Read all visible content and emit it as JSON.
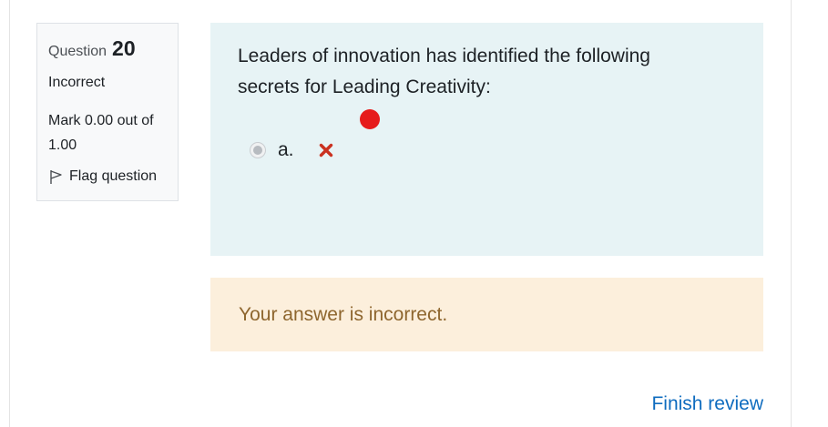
{
  "info": {
    "question_label": "Question",
    "question_number": "20",
    "state": "Incorrect",
    "mark": "Mark 0.00 out of 1.00",
    "flag_label": "Flag question",
    "flag_icon": "flag-outline-icon"
  },
  "question": {
    "text": "Leaders of innovation has identified the following secrets for Leading Creativity:",
    "answers": [
      {
        "label": "a.",
        "status_icon": "incorrect-x-icon"
      }
    ]
  },
  "feedback": {
    "text": "Your answer is incorrect."
  },
  "navigation": {
    "finish_review": "Finish review"
  },
  "colors": {
    "formulation_bg": "#e7f3f5",
    "feedback_bg": "#fcefdc",
    "feedback_text": "#8e662e",
    "link": "#0f6cbf",
    "incorrect_red": "#ca3120",
    "marker_red": "#e61b1b"
  }
}
